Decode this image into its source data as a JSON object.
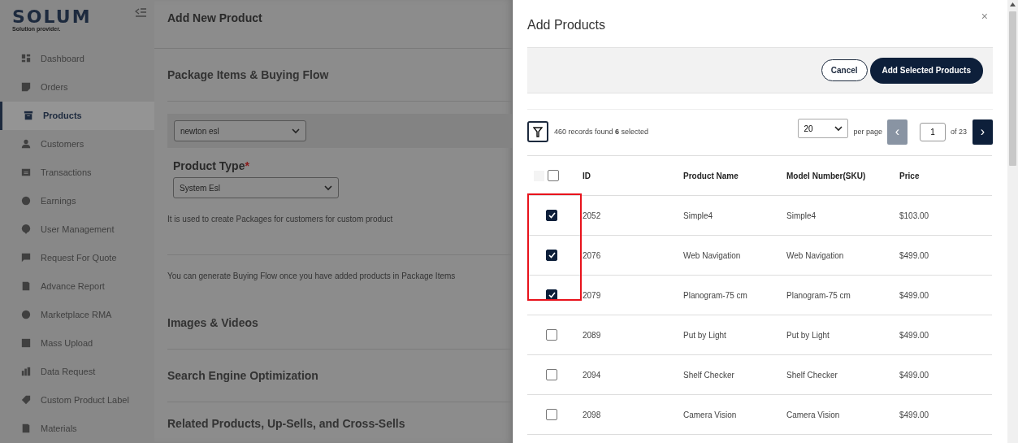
{
  "sidebar": {
    "logo": "SOLUM",
    "tagline": "Solution provider.",
    "items": [
      {
        "label": "Dashboard",
        "selected": false
      },
      {
        "label": "Orders",
        "selected": false
      },
      {
        "label": "Products",
        "selected": true
      },
      {
        "label": "Customers",
        "selected": false
      },
      {
        "label": "Transactions",
        "selected": false
      },
      {
        "label": "Earnings",
        "selected": false
      },
      {
        "label": "User Management",
        "selected": false
      },
      {
        "label": "Request For Quote",
        "selected": false
      },
      {
        "label": "Advance Report",
        "selected": false
      },
      {
        "label": "Marketplace RMA",
        "selected": false
      },
      {
        "label": "Mass Upload",
        "selected": false
      },
      {
        "label": "Data Request",
        "selected": false
      },
      {
        "label": "Custom Product Label",
        "selected": false
      },
      {
        "label": "Materials",
        "selected": false
      }
    ]
  },
  "page": {
    "title": "Add New Product",
    "section_title": "Package Items & Buying Flow",
    "package_select": "newton esl",
    "product_type_label": "Product Type",
    "required_mark": "*",
    "product_type_select": "System Esl",
    "help_text": "It is used to create Packages for customers for custom product",
    "buying_flow_note": "You can generate Buying Flow once you have added products in Package Items",
    "sections": [
      "Images & Videos",
      "Search Engine Optimization",
      "Related Products, Up-Sells, and Cross-Sells"
    ]
  },
  "modal": {
    "title": "Add Products",
    "close": "×",
    "cancel_button": "Cancel",
    "add_button": "Add Selected Products",
    "records_text": "460 records found **6** selected",
    "per_page_select": "20",
    "per_page_label": "per page",
    "prev": "‹",
    "page_input": "1",
    "page_total": "of 23",
    "next": "›",
    "columns": [
      "ID",
      "Product Name",
      "Model Number(SKU)",
      "Price"
    ],
    "header_checked": false,
    "rows": [
      {
        "id": "2052",
        "name": "Simple4",
        "sku": "Simple4",
        "price": "$103.00",
        "checked": true
      },
      {
        "id": "2076",
        "name": "Web Navigation",
        "sku": "Web Navigation",
        "price": "$499.00",
        "checked": true
      },
      {
        "id": "2079",
        "name": "Planogram-75 cm",
        "sku": "Planogram-75 cm",
        "price": "$499.00",
        "checked": true
      },
      {
        "id": "2089",
        "name": "Put by Light",
        "sku": "Put by Light",
        "price": "$499.00",
        "checked": false
      },
      {
        "id": "2094",
        "name": "Shelf Checker",
        "sku": "Shelf Checker",
        "price": "$499.00",
        "checked": false
      },
      {
        "id": "2098",
        "name": "Camera Vision",
        "sku": "Camera Vision",
        "price": "$499.00",
        "checked": false
      }
    ]
  }
}
